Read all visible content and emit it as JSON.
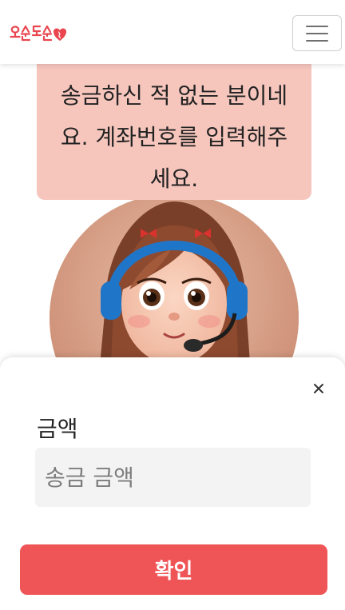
{
  "header": {
    "logo_text": "오순도순",
    "logo_icon": "heart-icon",
    "menu_icon": "hamburger-icon"
  },
  "bubble": {
    "text": "송금하신 적 없는 분이네요. 계좌번호를 입력해주세요."
  },
  "avatar": {
    "description_icon": "operator-girl-avatar"
  },
  "sheet": {
    "close_icon": "close-icon",
    "amount_label": "금액",
    "amount_placeholder": "송금 금액",
    "amount_value": "",
    "confirm_label": "확인"
  },
  "colors": {
    "accent": "#ef5456",
    "bubble_bg": "#f6c6bd",
    "logo": "#e9464f"
  }
}
